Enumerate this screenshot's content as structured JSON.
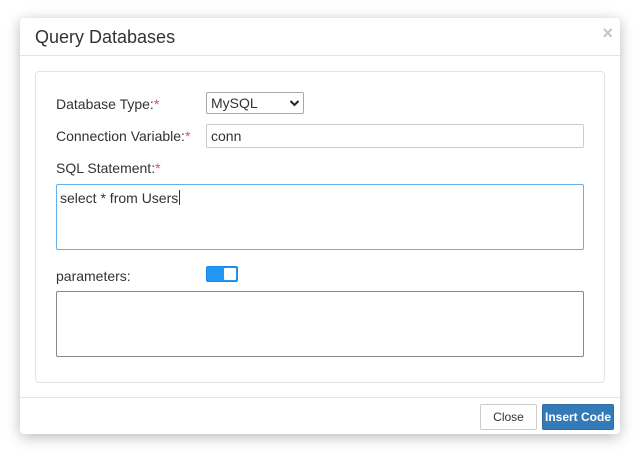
{
  "dialog": {
    "title": "Query Databases",
    "close_glyph": "×"
  },
  "form": {
    "database_type": {
      "label": "Database Type:",
      "required_mark": "*",
      "selected": "MySQL"
    },
    "connection_variable": {
      "label": "Connection Variable:",
      "required_mark": "*",
      "value": "conn"
    },
    "sql_statement": {
      "label": "SQL Statement:",
      "required_mark": "*",
      "value": "select * from Users"
    },
    "parameters": {
      "label": "parameters:",
      "toggle_on": true,
      "value": ""
    }
  },
  "footer": {
    "close_label": "Close",
    "insert_label": "Insert Code"
  },
  "colors": {
    "required": "#d9534f",
    "primary_button": "#337ab7",
    "toggle_active": "#2196f3",
    "focus_border": "#66afe9"
  }
}
